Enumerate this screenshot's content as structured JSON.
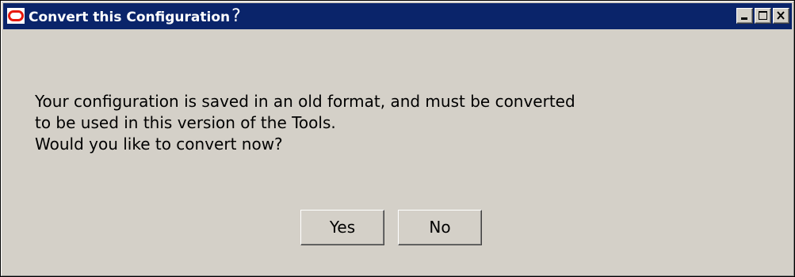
{
  "window": {
    "title": "Convert this Configuration",
    "title_suffix_glyph": "?",
    "icon": "oracle-logo-icon",
    "controls": [
      {
        "name": "minimize",
        "icon": "minimize-icon"
      },
      {
        "name": "maximize",
        "icon": "maximize-icon"
      },
      {
        "name": "close",
        "icon": "close-icon"
      }
    ]
  },
  "message": {
    "lines": [
      "Your configuration is saved in an old format, and must be converted",
      "to be used in this version of the Tools.",
      "Would you like to convert now?"
    ]
  },
  "buttons": {
    "yes_label": "Yes",
    "no_label": "No"
  },
  "colors": {
    "title_bar": "#0a246a",
    "dialog_background": "#d4d0c8",
    "logo_red": "#e8190d",
    "title_text": "#ffffff"
  }
}
